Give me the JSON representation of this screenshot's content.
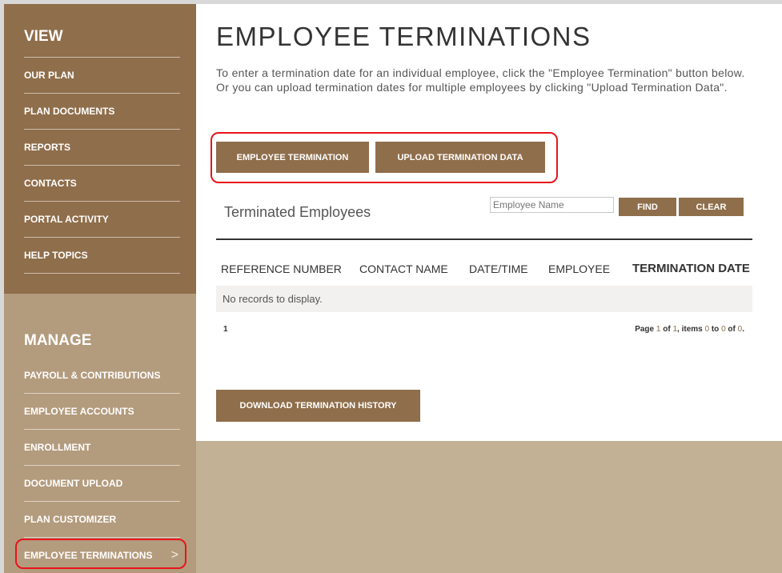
{
  "sidebar": {
    "view_heading": "VIEW",
    "view_items": [
      "OUR PLAN",
      "PLAN DOCUMENTS",
      "REPORTS",
      "CONTACTS",
      "PORTAL ACTIVITY",
      "HELP TOPICS"
    ],
    "manage_heading": "MANAGE",
    "manage_items": [
      "PAYROLL & CONTRIBUTIONS",
      "EMPLOYEE ACCOUNTS",
      "ENROLLMENT",
      "DOCUMENT UPLOAD",
      "PLAN CUSTOMIZER",
      "EMPLOYEE TERMINATIONS"
    ],
    "active_chevron": ">"
  },
  "main": {
    "title": "EMPLOYEE TERMINATIONS",
    "intro": "To enter a termination date for an individual employee, click the \"Employee Termination\" button below. Or you can upload termination dates for multiple employees by clicking \"Upload Termination Data\".",
    "employee_termination_label": "EMPLOYEE TERMINATION",
    "upload_label": "UPLOAD TERMINATION DATA",
    "download_label": "DOWNLOAD TERMINATION HISTORY"
  },
  "grid": {
    "title": "Terminated Employees",
    "search_placeholder": "Employee Name",
    "find_label": "FIND",
    "clear_label": "CLEAR",
    "columns": {
      "reference": "REFERENCE NUMBER",
      "contact": "CONTACT NAME",
      "datetime": "DATE/TIME",
      "employee": "EMPLOYEE",
      "termination_date": "TERMINATION DATE"
    },
    "no_records": "No records to display.",
    "pager": {
      "current_page": "1",
      "page_word": "Page",
      "page": "1",
      "of_word": "of",
      "total_pages": "1",
      "items_word": "items",
      "from": "0",
      "to_word": "to",
      "to": "0",
      "total": "0",
      "end": "."
    }
  }
}
